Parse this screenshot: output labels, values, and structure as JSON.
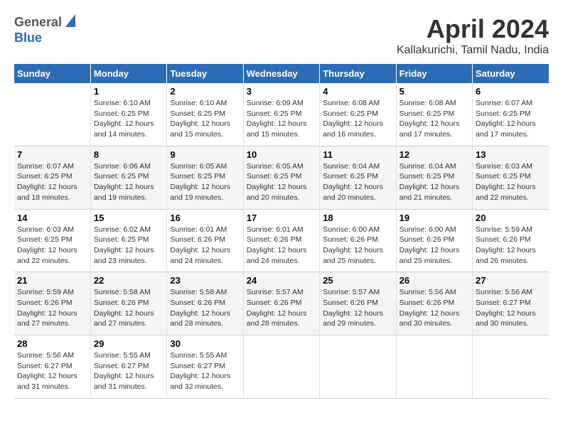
{
  "header": {
    "logo_general": "General",
    "logo_blue": "Blue",
    "title": "April 2024",
    "subtitle": "Kallakurichi, Tamil Nadu, India"
  },
  "calendar": {
    "days_of_week": [
      "Sunday",
      "Monday",
      "Tuesday",
      "Wednesday",
      "Thursday",
      "Friday",
      "Saturday"
    ],
    "weeks": [
      [
        {
          "day": "",
          "content": ""
        },
        {
          "day": "1",
          "content": "Sunrise: 6:10 AM\nSunset: 6:25 PM\nDaylight: 12 hours\nand 14 minutes."
        },
        {
          "day": "2",
          "content": "Sunrise: 6:10 AM\nSunset: 6:25 PM\nDaylight: 12 hours\nand 15 minutes."
        },
        {
          "day": "3",
          "content": "Sunrise: 6:09 AM\nSunset: 6:25 PM\nDaylight: 12 hours\nand 15 minutes."
        },
        {
          "day": "4",
          "content": "Sunrise: 6:08 AM\nSunset: 6:25 PM\nDaylight: 12 hours\nand 16 minutes."
        },
        {
          "day": "5",
          "content": "Sunrise: 6:08 AM\nSunset: 6:25 PM\nDaylight: 12 hours\nand 17 minutes."
        },
        {
          "day": "6",
          "content": "Sunrise: 6:07 AM\nSunset: 6:25 PM\nDaylight: 12 hours\nand 17 minutes."
        }
      ],
      [
        {
          "day": "7",
          "content": "Sunrise: 6:07 AM\nSunset: 6:25 PM\nDaylight: 12 hours\nand 18 minutes."
        },
        {
          "day": "8",
          "content": "Sunrise: 6:06 AM\nSunset: 6:25 PM\nDaylight: 12 hours\nand 19 minutes."
        },
        {
          "day": "9",
          "content": "Sunrise: 6:05 AM\nSunset: 6:25 PM\nDaylight: 12 hours\nand 19 minutes."
        },
        {
          "day": "10",
          "content": "Sunrise: 6:05 AM\nSunset: 6:25 PM\nDaylight: 12 hours\nand 20 minutes."
        },
        {
          "day": "11",
          "content": "Sunrise: 6:04 AM\nSunset: 6:25 PM\nDaylight: 12 hours\nand 20 minutes."
        },
        {
          "day": "12",
          "content": "Sunrise: 6:04 AM\nSunset: 6:25 PM\nDaylight: 12 hours\nand 21 minutes."
        },
        {
          "day": "13",
          "content": "Sunrise: 6:03 AM\nSunset: 6:25 PM\nDaylight: 12 hours\nand 22 minutes."
        }
      ],
      [
        {
          "day": "14",
          "content": "Sunrise: 6:03 AM\nSunset: 6:25 PM\nDaylight: 12 hours\nand 22 minutes."
        },
        {
          "day": "15",
          "content": "Sunrise: 6:02 AM\nSunset: 6:25 PM\nDaylight: 12 hours\nand 23 minutes."
        },
        {
          "day": "16",
          "content": "Sunrise: 6:01 AM\nSunset: 6:26 PM\nDaylight: 12 hours\nand 24 minutes."
        },
        {
          "day": "17",
          "content": "Sunrise: 6:01 AM\nSunset: 6:26 PM\nDaylight: 12 hours\nand 24 minutes."
        },
        {
          "day": "18",
          "content": "Sunrise: 6:00 AM\nSunset: 6:26 PM\nDaylight: 12 hours\nand 25 minutes."
        },
        {
          "day": "19",
          "content": "Sunrise: 6:00 AM\nSunset: 6:26 PM\nDaylight: 12 hours\nand 25 minutes."
        },
        {
          "day": "20",
          "content": "Sunrise: 5:59 AM\nSunset: 6:26 PM\nDaylight: 12 hours\nand 26 minutes."
        }
      ],
      [
        {
          "day": "21",
          "content": "Sunrise: 5:59 AM\nSunset: 6:26 PM\nDaylight: 12 hours\nand 27 minutes."
        },
        {
          "day": "22",
          "content": "Sunrise: 5:58 AM\nSunset: 6:26 PM\nDaylight: 12 hours\nand 27 minutes."
        },
        {
          "day": "23",
          "content": "Sunrise: 5:58 AM\nSunset: 6:26 PM\nDaylight: 12 hours\nand 28 minutes."
        },
        {
          "day": "24",
          "content": "Sunrise: 5:57 AM\nSunset: 6:26 PM\nDaylight: 12 hours\nand 28 minutes."
        },
        {
          "day": "25",
          "content": "Sunrise: 5:57 AM\nSunset: 6:26 PM\nDaylight: 12 hours\nand 29 minutes."
        },
        {
          "day": "26",
          "content": "Sunrise: 5:56 AM\nSunset: 6:26 PM\nDaylight: 12 hours\nand 30 minutes."
        },
        {
          "day": "27",
          "content": "Sunrise: 5:56 AM\nSunset: 6:27 PM\nDaylight: 12 hours\nand 30 minutes."
        }
      ],
      [
        {
          "day": "28",
          "content": "Sunrise: 5:56 AM\nSunset: 6:27 PM\nDaylight: 12 hours\nand 31 minutes."
        },
        {
          "day": "29",
          "content": "Sunrise: 5:55 AM\nSunset: 6:27 PM\nDaylight: 12 hours\nand 31 minutes."
        },
        {
          "day": "30",
          "content": "Sunrise: 5:55 AM\nSunset: 6:27 PM\nDaylight: 12 hours\nand 32 minutes."
        },
        {
          "day": "",
          "content": ""
        },
        {
          "day": "",
          "content": ""
        },
        {
          "day": "",
          "content": ""
        },
        {
          "day": "",
          "content": ""
        }
      ]
    ]
  }
}
